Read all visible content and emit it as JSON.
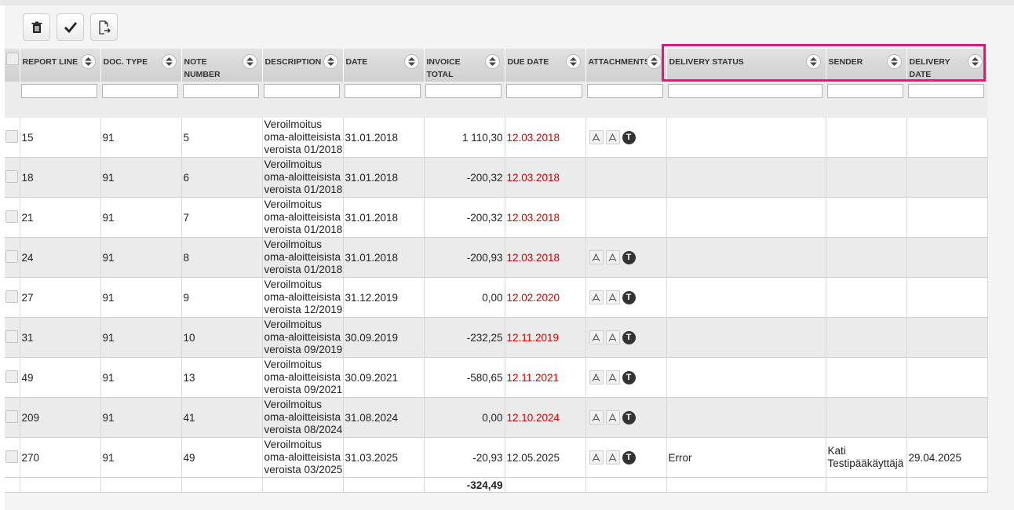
{
  "toolbar": {
    "delete_icon": "trash-icon",
    "approve_icon": "checkmark-icon",
    "export_icon": "export-file-icon"
  },
  "columns": [
    {
      "key": "report_line",
      "label": "REPORT LINE"
    },
    {
      "key": "doc_type",
      "label": "DOC. TYPE"
    },
    {
      "key": "note_number",
      "label": "NOTE NUMBER"
    },
    {
      "key": "description",
      "label": "DESCRIPTION"
    },
    {
      "key": "date",
      "label": "DATE"
    },
    {
      "key": "invoice_total",
      "label": "INVOICE TOTAL"
    },
    {
      "key": "due_date",
      "label": "DUE DATE"
    },
    {
      "key": "attachments",
      "label": "ATTACHMENTS"
    },
    {
      "key": "delivery_status",
      "label": "DELIVERY STATUS"
    },
    {
      "key": "sender",
      "label": "SENDER"
    },
    {
      "key": "delivery_date",
      "label": "DELIVERY DATE"
    }
  ],
  "rows": [
    {
      "report_line": "15",
      "doc_type": "91",
      "note_number": "5",
      "description": "Veroilmoitus oma-aloitteisista veroista 01/2018",
      "date": "31.01.2018",
      "invoice_total": "1 110,30",
      "due_date": "12.03.2018",
      "due_overdue": true,
      "attachments": true,
      "delivery_status": "",
      "sender": "",
      "delivery_date": ""
    },
    {
      "report_line": "18",
      "doc_type": "91",
      "note_number": "6",
      "description": "Veroilmoitus oma-aloitteisista veroista 01/2018",
      "date": "31.01.2018",
      "invoice_total": "-200,32",
      "due_date": "12.03.2018",
      "due_overdue": true,
      "attachments": false,
      "delivery_status": "",
      "sender": "",
      "delivery_date": ""
    },
    {
      "report_line": "21",
      "doc_type": "91",
      "note_number": "7",
      "description": "Veroilmoitus oma-aloitteisista veroista 01/2018",
      "date": "31.01.2018",
      "invoice_total": "-200,32",
      "due_date": "12.03.2018",
      "due_overdue": true,
      "attachments": false,
      "delivery_status": "",
      "sender": "",
      "delivery_date": ""
    },
    {
      "report_line": "24",
      "doc_type": "91",
      "note_number": "8",
      "description": "Veroilmoitus oma-aloitteisista veroista 01/2018",
      "date": "31.01.2018",
      "invoice_total": "-200,93",
      "due_date": "12.03.2018",
      "due_overdue": true,
      "attachments": true,
      "delivery_status": "",
      "sender": "",
      "delivery_date": ""
    },
    {
      "report_line": "27",
      "doc_type": "91",
      "note_number": "9",
      "description": "Veroilmoitus oma-aloitteisista veroista 12/2019",
      "date": "31.12.2019",
      "invoice_total": "0,00",
      "due_date": "12.02.2020",
      "due_overdue": true,
      "attachments": true,
      "delivery_status": "",
      "sender": "",
      "delivery_date": ""
    },
    {
      "report_line": "31",
      "doc_type": "91",
      "note_number": "10",
      "description": "Veroilmoitus oma-aloitteisista veroista 09/2019",
      "date": "30.09.2019",
      "invoice_total": "-232,25",
      "due_date": "12.11.2019",
      "due_overdue": true,
      "attachments": true,
      "delivery_status": "",
      "sender": "",
      "delivery_date": ""
    },
    {
      "report_line": "49",
      "doc_type": "91",
      "note_number": "13",
      "description": "Veroilmoitus oma-aloitteisista veroista 09/2021",
      "date": "30.09.2021",
      "invoice_total": "-580,65",
      "due_date": "12.11.2021",
      "due_overdue": true,
      "attachments": true,
      "delivery_status": "",
      "sender": "",
      "delivery_date": ""
    },
    {
      "report_line": "209",
      "doc_type": "91",
      "note_number": "41",
      "description": "Veroilmoitus oma-aloitteisista veroista 08/2024",
      "date": "31.08.2024",
      "invoice_total": "0,00",
      "due_date": "12.10.2024",
      "due_overdue": true,
      "attachments": true,
      "delivery_status": "",
      "sender": "",
      "delivery_date": ""
    },
    {
      "report_line": "270",
      "doc_type": "91",
      "note_number": "49",
      "description": "Veroilmoitus oma-aloitteisista veroista 03/2025",
      "date": "31.03.2025",
      "invoice_total": "-20,93",
      "due_date": "12.05.2025",
      "due_overdue": false,
      "attachments": true,
      "delivery_status": "Error",
      "sender": "Kati Testipääkäyttäjä",
      "delivery_date": "29.04.2025"
    }
  ],
  "total": {
    "invoice_total": "-324,49"
  },
  "attachment_icons": [
    "pdf-icon",
    "pdf-icon",
    "t-icon"
  ],
  "attachment_t_label": "T",
  "colors": {
    "overdue": "#d40000",
    "highlight": "#e0197d"
  }
}
